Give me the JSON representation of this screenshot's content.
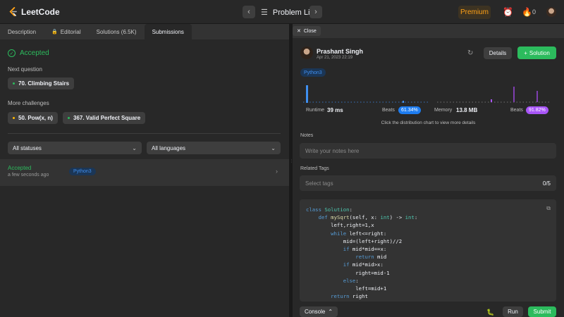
{
  "app": {
    "logo_text": "LeetCode"
  },
  "header": {
    "problem_list_label": "Problem List",
    "premium_label": "Premium",
    "streak_count": "0"
  },
  "left": {
    "tabs": [
      {
        "label": "Description"
      },
      {
        "label": "Editorial"
      },
      {
        "label": "Solutions (6.5K)"
      },
      {
        "label": "Submissions"
      }
    ],
    "status": "Accepted",
    "next_question_label": "Next question",
    "next_question": "70. Climbing Stairs",
    "more_challenges_label": "More challenges",
    "challenges": [
      "50. Pow(x, n)",
      "367. Valid Perfect Square"
    ],
    "status_filter": "All statuses",
    "language_filter": "All languages",
    "submission": {
      "status": "Accepted",
      "time": "a few seconds ago",
      "language": "Python3"
    }
  },
  "right": {
    "close_label": "Close",
    "user_name": "Prashant Singh",
    "date": "Apr 21, 2023 22:19",
    "details_label": "Details",
    "solution_label": "Solution",
    "language": "Python3",
    "runtime_label": "Runtime",
    "runtime_value": "39 ms",
    "runtime_beats_label": "Beats",
    "runtime_beats": "61.34%",
    "memory_label": "Memory",
    "memory_value": "13.8 MB",
    "memory_beats_label": "Beats",
    "memory_beats": "91.82%",
    "chart_hint": "Click the distribution chart to view more details",
    "notes_label": "Notes",
    "notes_placeholder": "Write your notes here",
    "tags_label": "Related Tags",
    "tags_placeholder": "Select tags",
    "tags_count": "0/5",
    "console_label": "Console",
    "run_label": "Run",
    "submit_label": "Submit"
  },
  "colors": {
    "accent_green": "#2cbb5d",
    "premium_orange": "#ffa116",
    "runtime_blue": "#3f8ff0",
    "memory_purple": "#a855f7"
  }
}
